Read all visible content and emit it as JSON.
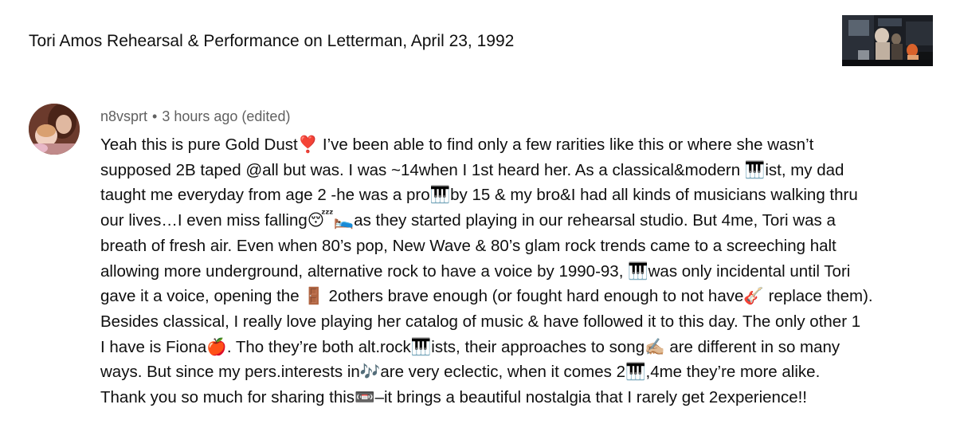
{
  "video": {
    "title": "Tori Amos Rehearsal & Performance on Letterman, April 23, 1992"
  },
  "comment": {
    "author": "n8vsprt",
    "separator": "•",
    "timestamp": "3 hours ago (edited)",
    "lines": [
      "Yeah this is pure Gold Dust❣️  I’ve been able to find only a few rarities like this or where she wasn’t",
      "supposed 2B taped @all but was.  I was ~14when I 1st heard her.  As a classical&modern 🎹ist, my dad",
      "taught me everyday from age 2 -he was a pro🎹by 15 & my bro&I had all kinds of musicians walking thru",
      "our lives…I even miss falling😴🛌as they started playing in our rehearsal studio.  But 4me, Tori was a",
      "breath of fresh air.  Even when 80’s pop, New Wave & 80’s glam rock trends came to a screeching halt",
      "allowing more underground, alternative rock to have a voice by 1990-93, 🎹was only incidental until Tori",
      "gave it a voice, opening the 🚪 2others brave enough (or fought hard enough to not have🎸 replace them).",
      "Besides classical, I really love playing her catalog of music & have followed it to this day.  The only other 1",
      "I have is Fiona🍎.  Tho they’re both alt.rock🎹ists, their approaches to song✍🏼 are different in so many",
      "ways.  But since my pers.interests in🎶are very eclectic, when it comes 2🎹,4me they’re more alike.",
      "Thank you so much for sharing this📼–it brings a beautiful nostalgia that I rarely get 2experience!!"
    ]
  }
}
